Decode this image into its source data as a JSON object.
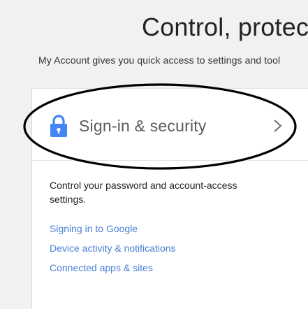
{
  "hero": {
    "title": "Control, protect",
    "subtitle": "My Account gives you quick access to settings and tool"
  },
  "card": {
    "header_label": "Sign-in & security",
    "description": "Control your password and account-access settings.",
    "links": [
      "Signing in to Google",
      "Device activity & notifications",
      "Connected apps & sites"
    ]
  },
  "colors": {
    "lock_icon": "#4285f4",
    "link": "#4a7fd6",
    "annotation": "#000000"
  },
  "icons": {
    "lock": "lock-icon",
    "chevron": "chevron-right-icon"
  }
}
